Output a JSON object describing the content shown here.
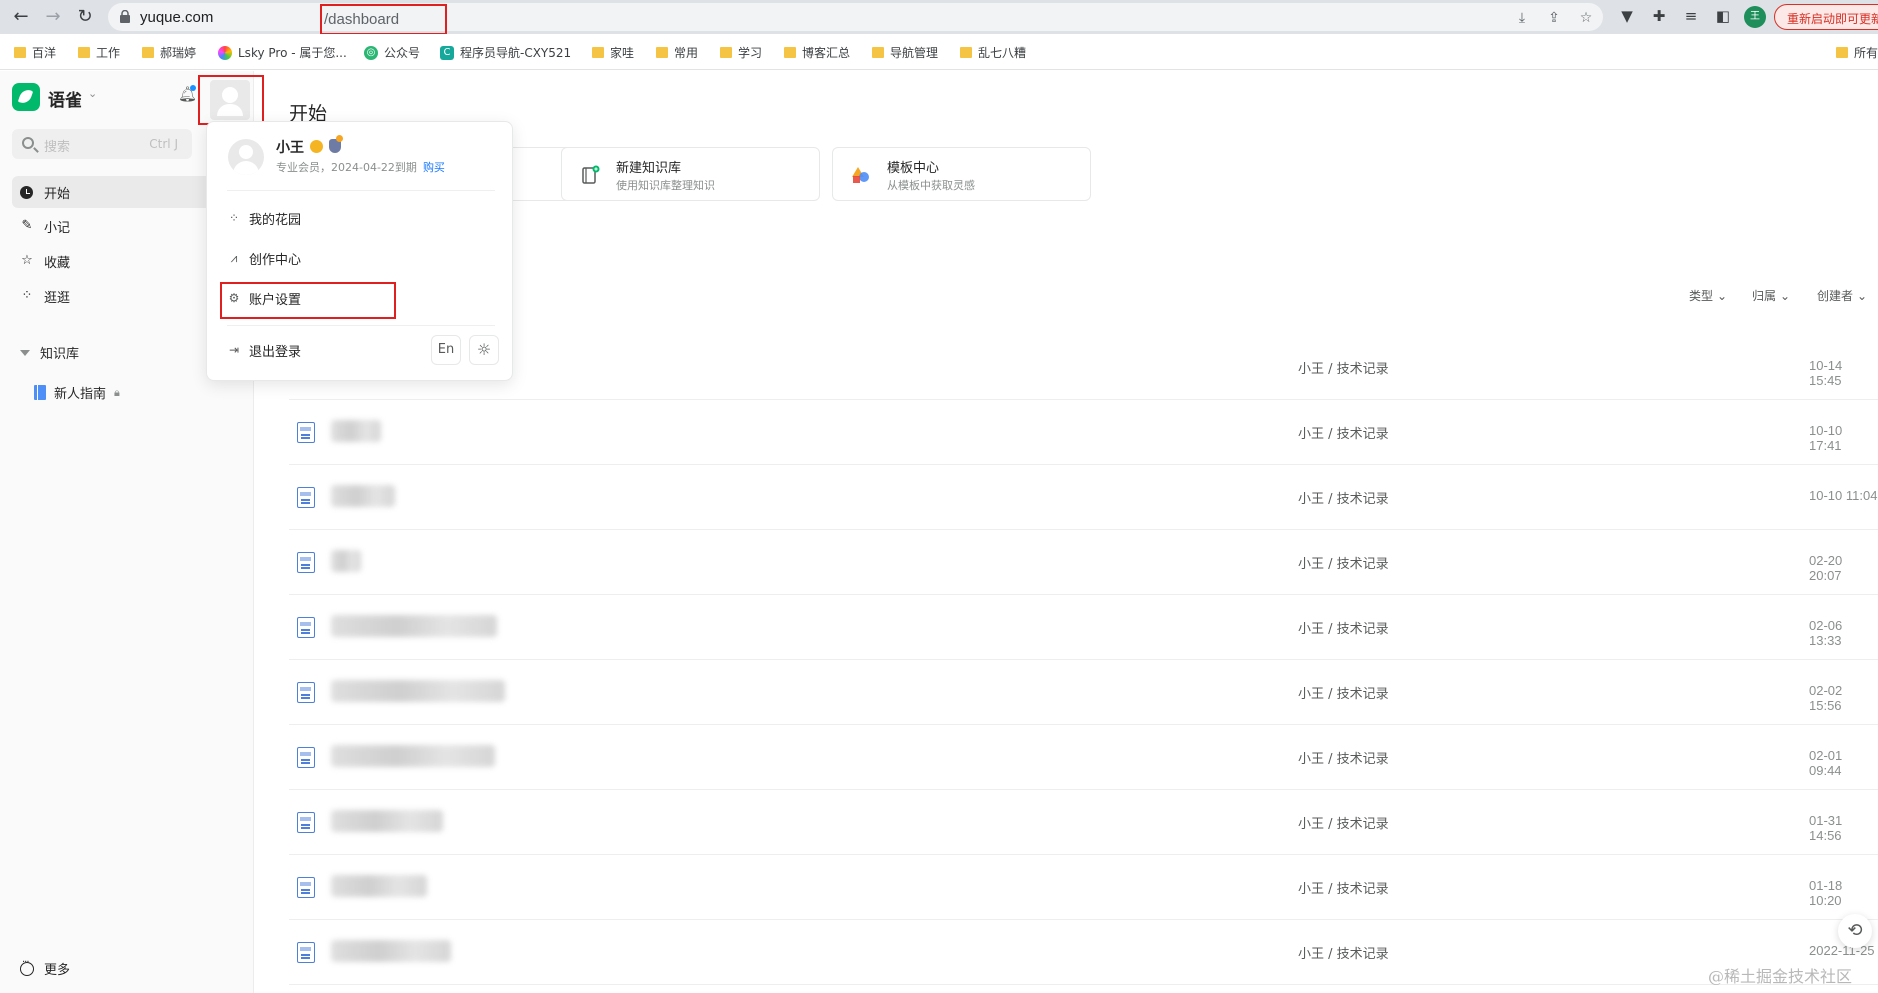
{
  "browser": {
    "url_host": "yuque.com",
    "url_path": "/dashboard",
    "update_label": "重新启动即可更新",
    "profile_initial": "王"
  },
  "bookmarks": [
    {
      "label": "百洋",
      "icon": "folder"
    },
    {
      "label": "工作",
      "icon": "folder"
    },
    {
      "label": "郝瑞婷",
      "icon": "folder"
    },
    {
      "label": "Lsky Pro - 属于您...",
      "icon": "pinwheel-icon"
    },
    {
      "label": "公众号",
      "icon": "spiral-icon"
    },
    {
      "label": "程序员导航-CXY521",
      "icon": "c-logo-icon"
    },
    {
      "label": "家哇",
      "icon": "folder"
    },
    {
      "label": "常用",
      "icon": "folder"
    },
    {
      "label": "学习",
      "icon": "folder"
    },
    {
      "label": "博客汇总",
      "icon": "folder"
    },
    {
      "label": "导航管理",
      "icon": "folder"
    },
    {
      "label": "乱七八糟",
      "icon": "folder"
    },
    {
      "label": "所有",
      "icon": "folder"
    }
  ],
  "sidebar": {
    "brand": "语雀",
    "search_placeholder": "搜索",
    "search_shortcut": "Ctrl J",
    "nav": [
      {
        "label": "开始",
        "icon": "clock-icon",
        "active": true
      },
      {
        "label": "小记",
        "icon": "feather-icon"
      },
      {
        "label": "收藏",
        "icon": "star-icon"
      },
      {
        "label": "逛逛",
        "icon": "grid-icon"
      }
    ],
    "kb_section": "知识库",
    "kb_items": [
      {
        "label": "新人指南",
        "icon": "book-icon",
        "locked": true
      }
    ],
    "more": "更多"
  },
  "main": {
    "title": "开始",
    "quick_cards": [
      {
        "title": "新建知识库",
        "sub": "使用知识库整理知识",
        "icon": "new-book-icon"
      },
      {
        "title": "模板中心",
        "sub": "从模板中获取灵感",
        "icon": "template-icon"
      }
    ],
    "filters": [
      "类型",
      "归属",
      "创建者"
    ],
    "docs": [
      {
        "title": "",
        "book": "小王 / 技术记录",
        "time": "10-14 15:45"
      },
      {
        "title": "",
        "book": "小王 / 技术记录",
        "time": "10-10 17:41"
      },
      {
        "title": "",
        "book": "小王 / 技术记录",
        "time": "10-10 11:04"
      },
      {
        "title": "",
        "book": "小王 / 技术记录",
        "time": "02-20 20:07"
      },
      {
        "title": "",
        "book": "小王 / 技术记录",
        "time": "02-06 13:33"
      },
      {
        "title": "",
        "book": "小王 / 技术记录",
        "time": "02-02 15:56"
      },
      {
        "title": "",
        "book": "小王 / 技术记录",
        "time": "02-01 09:44"
      },
      {
        "title": "",
        "book": "小王 / 技术记录",
        "time": "01-31 14:56"
      },
      {
        "title": "",
        "book": "小王 / 技术记录",
        "time": "01-18 10:20"
      },
      {
        "title": "",
        "book": "小王 / 技术记录",
        "time": "2022-11-25"
      }
    ]
  },
  "user_menu": {
    "name": "小王",
    "membership": "专业会员，2024-04-22到期",
    "buy": "购买",
    "items": [
      {
        "label": "我的花园",
        "icon": "garden-icon"
      },
      {
        "label": "创作中心",
        "icon": "chart-icon"
      },
      {
        "label": "账户设置",
        "icon": "gear-icon"
      }
    ],
    "logout": "退出登录",
    "lang": "En",
    "theme_icon": "sun-icon"
  },
  "watermark": "@稀土掘金技术社区"
}
